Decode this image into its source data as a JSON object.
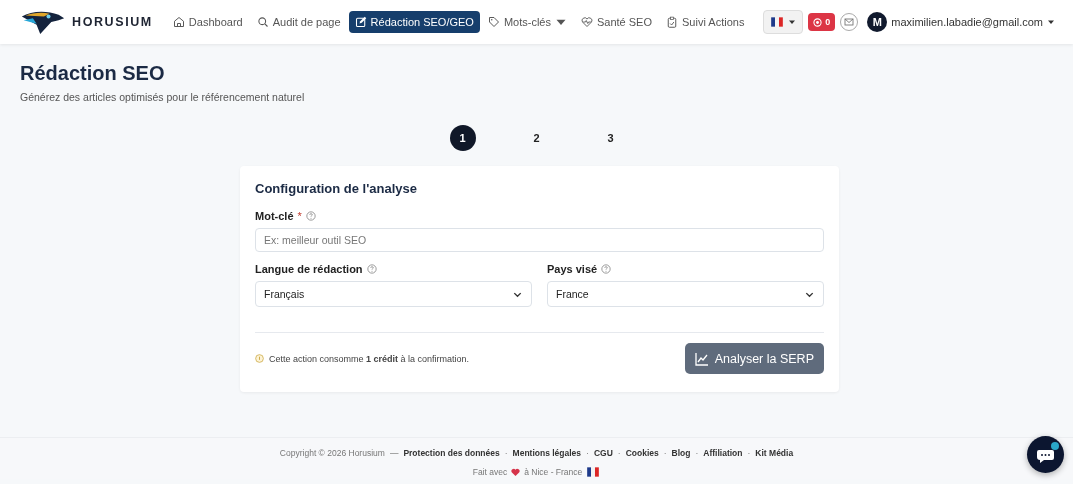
{
  "brand": "HORUSIUM",
  "nav": [
    {
      "label": "Dashboard",
      "selected": false,
      "dropdown": false
    },
    {
      "label": "Audit de page",
      "selected": false,
      "dropdown": false
    },
    {
      "label": "Rédaction SEO/GEO",
      "selected": true,
      "dropdown": false
    },
    {
      "label": "Mots-clés",
      "selected": false,
      "dropdown": true
    },
    {
      "label": "Santé SEO",
      "selected": false,
      "dropdown": false
    },
    {
      "label": "Suivi Actions",
      "selected": false,
      "dropdown": false
    }
  ],
  "credits_badge": "0",
  "user": {
    "initial": "M",
    "email": "maximilien.labadie@gmail.com"
  },
  "page": {
    "title": "Rédaction SEO",
    "subtitle": "Générez des articles optimisés pour le référencement naturel"
  },
  "steps": [
    {
      "label": "1",
      "selected": true
    },
    {
      "label": "2",
      "selected": false
    },
    {
      "label": "3",
      "selected": false
    }
  ],
  "card": {
    "title": "Configuration de l'analyse",
    "keyword": {
      "label": "Mot-clé",
      "required_mark": "*",
      "placeholder": "Ex: meilleur outil SEO"
    },
    "language": {
      "label": "Langue de rédaction",
      "value": "Français"
    },
    "country": {
      "label": "Pays visé",
      "value": "France"
    },
    "note": "Cette action consomme **1 crédit** à la confirmation.",
    "button": "Analyser la SERP"
  },
  "footer": {
    "copyright": "Copyright © 2026 Horusium",
    "separator": "—",
    "links": [
      "Protection des données",
      "Mentions légales",
      "CGU",
      "Cookies",
      "Blog",
      "Affiliation",
      "Kit Média"
    ],
    "dot": "·",
    "made_with": "Fait avec",
    "made_in": "à Nice - France"
  }
}
